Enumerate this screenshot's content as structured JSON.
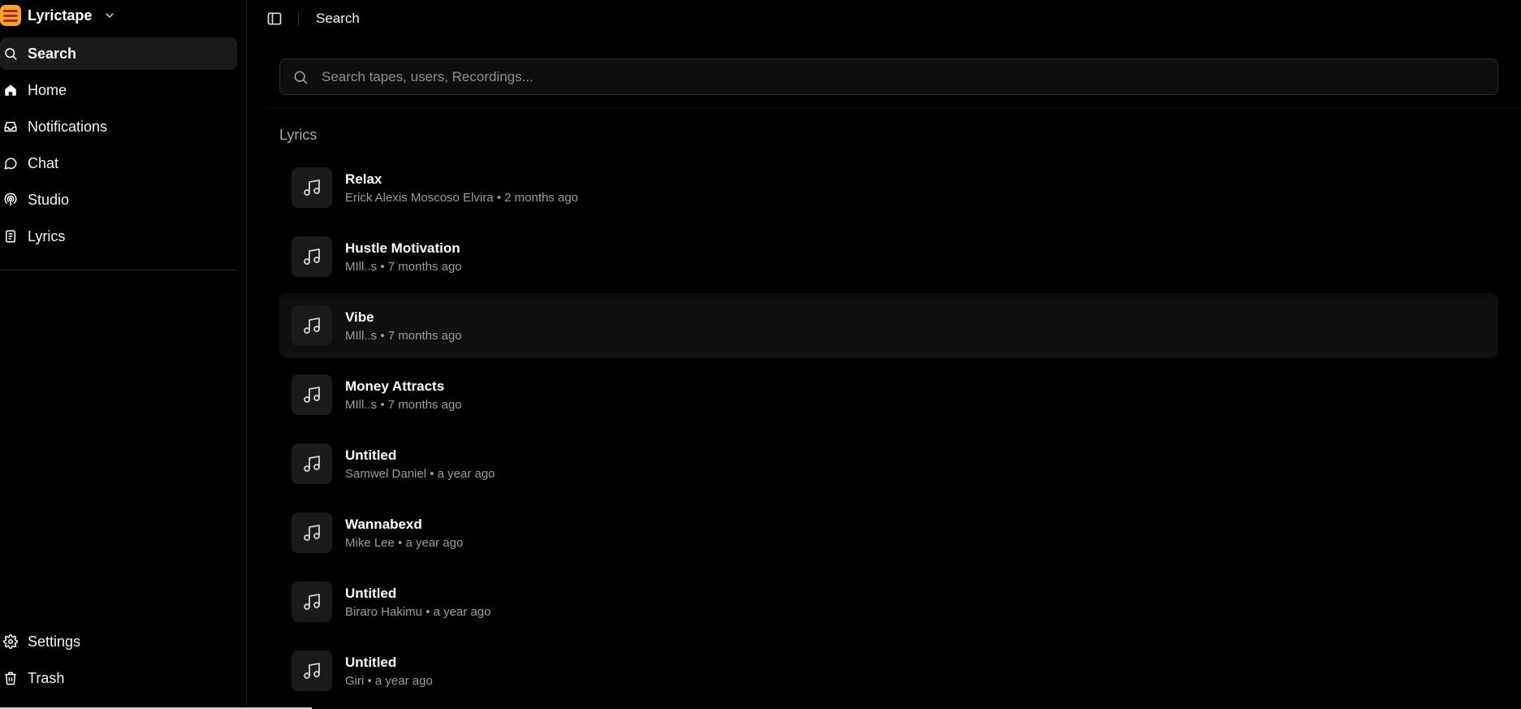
{
  "app": {
    "name": "Lyrictape"
  },
  "nav": {
    "items": [
      {
        "label": "Search",
        "icon": "search-icon",
        "active": true
      },
      {
        "label": "Home",
        "icon": "home-icon"
      },
      {
        "label": "Notifications",
        "icon": "inbox-icon"
      },
      {
        "label": "Chat",
        "icon": "chat-icon"
      },
      {
        "label": "Studio",
        "icon": "podcast-icon"
      },
      {
        "label": "Lyrics",
        "icon": "document-icon"
      }
    ],
    "bottom": [
      {
        "label": "Settings",
        "icon": "gear-icon"
      },
      {
        "label": "Trash",
        "icon": "trash-icon"
      }
    ]
  },
  "topbar": {
    "title": "Search"
  },
  "search": {
    "placeholder": "Search tapes, users, Recordings...",
    "value": ""
  },
  "section": {
    "title": "Lyrics"
  },
  "results": [
    {
      "title": "Relax",
      "meta": "Erick Alexis Moscoso Elvira • 2 months ago"
    },
    {
      "title": "Hustle Motivation",
      "meta": "MIll..s • 7 months ago"
    },
    {
      "title": "Vibe",
      "meta": "MIll..s • 7 months ago"
    },
    {
      "title": "Money Attracts",
      "meta": "MIll..s • 7 months ago"
    },
    {
      "title": "Untitled",
      "meta": "Samwel Daniel • a year ago"
    },
    {
      "title": "Wannabexd",
      "meta": "Mike Lee • a year ago"
    },
    {
      "title": "Untitled",
      "meta": "Biraro Hakimu • a year ago"
    },
    {
      "title": "Untitled",
      "meta": "Giri • a year ago"
    }
  ],
  "colors": {
    "background": "#000000",
    "surface": "#1a1a1a",
    "brand": "#f5a623",
    "brand_accent": "#b0281d",
    "muted_text": "#9c9c9c"
  }
}
